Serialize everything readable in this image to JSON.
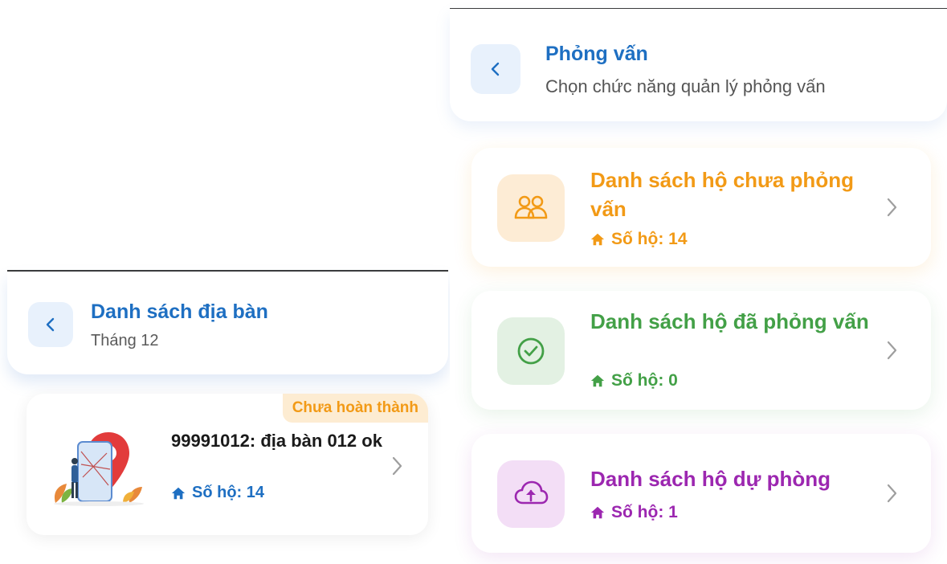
{
  "left": {
    "header": {
      "title": "Danh sách địa bàn",
      "subtitle": "Tháng 12"
    },
    "area_card": {
      "status": "Chưa hoàn thành",
      "name": "99991012: địa bàn 012 ok",
      "count_label": "Số hộ: 14",
      "illustration": "map-pin-illustration"
    }
  },
  "right": {
    "header": {
      "title": "Phỏng vấn",
      "subtitle": "Chọn chức năng quản lý phỏng vấn"
    },
    "menu": [
      {
        "label": "Danh sách hộ chưa phỏng vấn",
        "count_label": "Số hộ: 14",
        "icon": "users-icon",
        "color": "#f29a16"
      },
      {
        "label": "Danh sách hộ đã phỏng vấn",
        "count_label": "Số hộ: 0",
        "icon": "check-circle-icon",
        "color": "#43a047"
      },
      {
        "label": "Danh sách hộ dự phòng",
        "count_label": "Số hộ: 1",
        "icon": "cloud-upload-icon",
        "color": "#9c27b0"
      }
    ]
  },
  "colors": {
    "primary": "#1e6fc2",
    "pending": "#f29a16",
    "done": "#43a047",
    "reserve": "#9c27b0",
    "badge_bg": "#fdecd2"
  }
}
